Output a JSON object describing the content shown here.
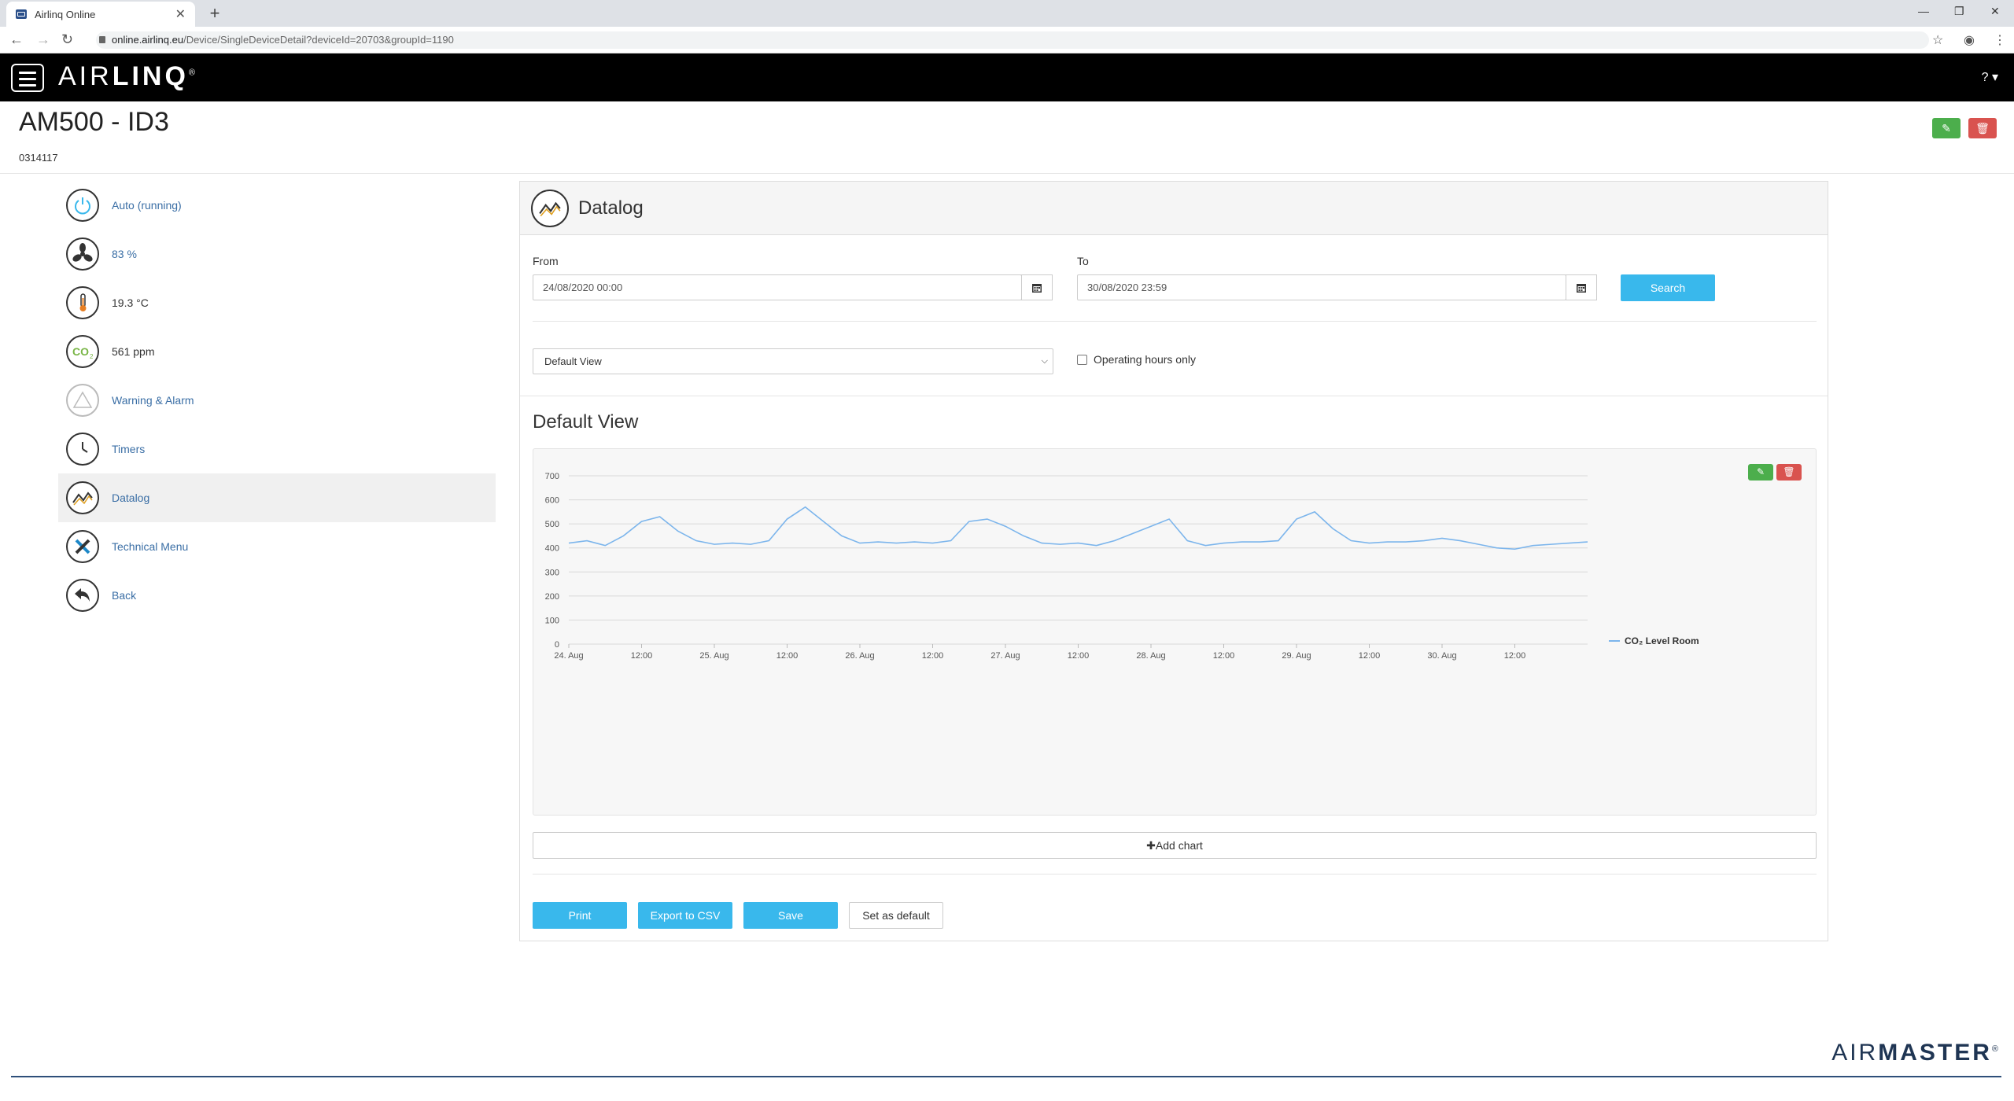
{
  "browser": {
    "tab_title": "Airlinq Online",
    "tab_close": "✕",
    "new_tab": "+",
    "url_host": "online.airlinq.eu",
    "url_path": "/Device/SingleDeviceDetail?deviceId=20703&groupId=1190"
  },
  "app": {
    "logo_light": "AIR",
    "logo_bold": "LINQ",
    "logo_mark": "®",
    "help": "? ▾"
  },
  "page": {
    "title": "AM500 - ID3",
    "serial": "0314117"
  },
  "sidebar": {
    "items": [
      {
        "label": "Auto (running)",
        "icon": "power-icon"
      },
      {
        "label": "83 %",
        "icon": "fan-icon"
      },
      {
        "label": "19.3 °C",
        "icon": "thermometer-icon"
      },
      {
        "label": "561 ppm",
        "icon": "co2-icon"
      },
      {
        "label": "Warning & Alarm",
        "icon": "warning-icon"
      },
      {
        "label": "Timers",
        "icon": "clock-icon"
      },
      {
        "label": "Datalog",
        "icon": "datalog-icon"
      },
      {
        "label": "Technical Menu",
        "icon": "tools-icon"
      },
      {
        "label": "Back",
        "icon": "back-icon"
      }
    ]
  },
  "datalog": {
    "header": "Datalog",
    "from_label": "From",
    "from_value": "24/08/2020 00:00",
    "to_label": "To",
    "to_value": "30/08/2020 23:59",
    "search": "Search",
    "view_select": "Default View",
    "operating_hours": "Operating hours only",
    "view_title": "Default View",
    "add_chart": "Add chart",
    "add_chart_icon": "✚",
    "buttons": {
      "print": "Print",
      "export": "Export to CSV",
      "save": "Save",
      "set_default": "Set as default"
    }
  },
  "colors": {
    "accent": "#39b8ec",
    "edit": "#4cae4c",
    "delete": "#d9534f",
    "series": "#7cb5ec"
  },
  "chart_data": {
    "type": "line",
    "title": "",
    "xlabel": "",
    "ylabel": "",
    "ylim": [
      0,
      700
    ],
    "yticks": [
      0,
      100,
      200,
      300,
      400,
      500,
      600,
      700
    ],
    "xticks": [
      "24. Aug",
      "12:00",
      "25. Aug",
      "12:00",
      "26. Aug",
      "12:00",
      "27. Aug",
      "12:00",
      "28. Aug",
      "12:00",
      "29. Aug",
      "12:00",
      "30. Aug",
      "12:00"
    ],
    "legend": "right",
    "series": [
      {
        "name": "CO₂ Level Room",
        "x_hours": [
          0,
          3,
          6,
          9,
          12,
          15,
          18,
          21,
          24,
          27,
          30,
          33,
          36,
          39,
          42,
          45,
          48,
          51,
          54,
          57,
          60,
          63,
          66,
          69,
          72,
          75,
          78,
          81,
          84,
          87,
          90,
          93,
          96,
          99,
          102,
          105,
          108,
          111,
          114,
          117,
          120,
          123,
          126,
          129,
          132,
          135,
          138,
          141,
          144,
          147,
          150,
          153,
          156,
          159,
          162,
          165,
          168
        ],
        "values": [
          420,
          430,
          410,
          450,
          510,
          530,
          470,
          430,
          415,
          420,
          415,
          430,
          520,
          570,
          510,
          450,
          420,
          425,
          420,
          425,
          420,
          430,
          510,
          520,
          490,
          450,
          420,
          415,
          420,
          410,
          430,
          460,
          490,
          520,
          430,
          410,
          420,
          425,
          425,
          430,
          520,
          550,
          480,
          430,
          420,
          425,
          425,
          430,
          440,
          430,
          415,
          400,
          395,
          410,
          415,
          420,
          425
        ]
      }
    ]
  }
}
